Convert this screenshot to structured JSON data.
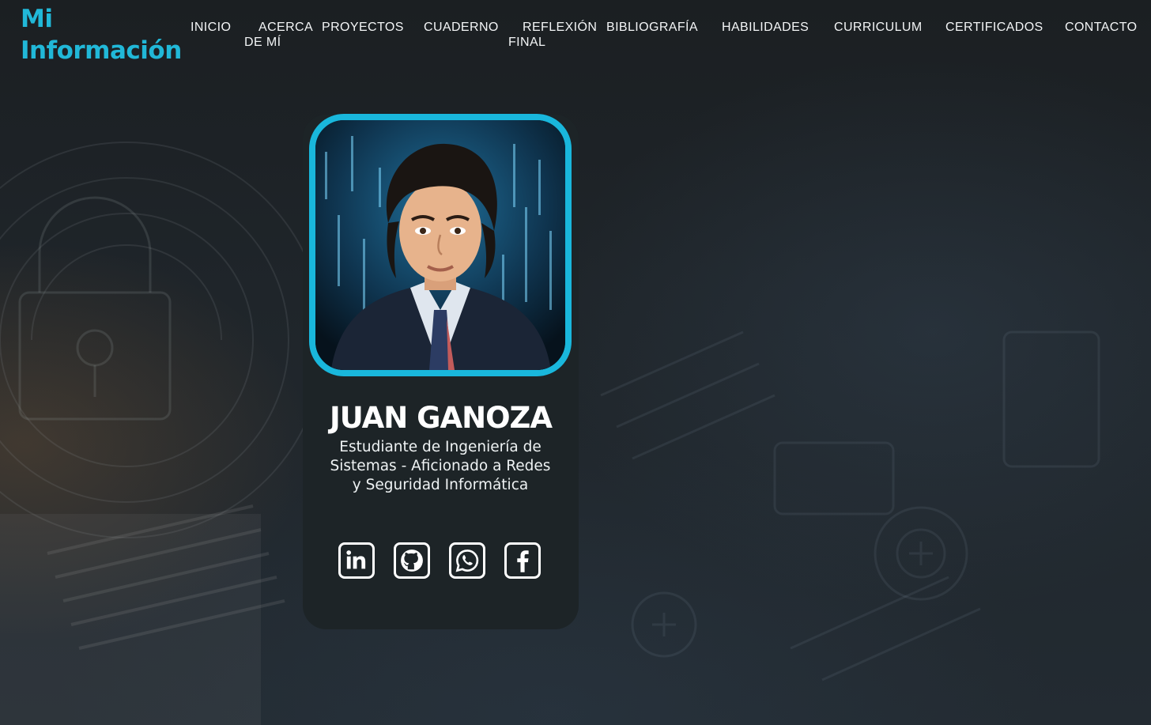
{
  "brand": {
    "line1": "Mi",
    "line2": "Información",
    "color": "#21b8d8"
  },
  "nav": {
    "items": [
      {
        "label1": "INICIO",
        "label2": ""
      },
      {
        "label1": "ACERCA",
        "label2": "DE MÍ"
      },
      {
        "label1": "PROYECTOS",
        "label2": ""
      },
      {
        "label1": "CUADERNO",
        "label2": ""
      },
      {
        "label1": "REFLEXIÓN",
        "label2": "FINAL"
      },
      {
        "label1": "BIBLIOGRAFÍA",
        "label2": ""
      },
      {
        "label1": "HABILIDADES",
        "label2": ""
      },
      {
        "label1": "CURRICULUM",
        "label2": ""
      },
      {
        "label1": "CERTIFICADOS",
        "label2": ""
      },
      {
        "label1": "CONTACTO",
        "label2": ""
      }
    ]
  },
  "profile": {
    "name": "JUAN GANOZA",
    "subtitle_line1": "Estudiante de Ingeniería de",
    "subtitle_line2": "Sistemas - Aficionado a Redes",
    "subtitle_line3": "y Seguridad Informática",
    "avatar_icon": "cartoon-portrait",
    "accent_color": "#19b7dc"
  },
  "social": [
    {
      "icon": "linkedin-icon"
    },
    {
      "icon": "github-icon"
    },
    {
      "icon": "whatsapp-icon"
    },
    {
      "icon": "facebook-icon"
    }
  ]
}
